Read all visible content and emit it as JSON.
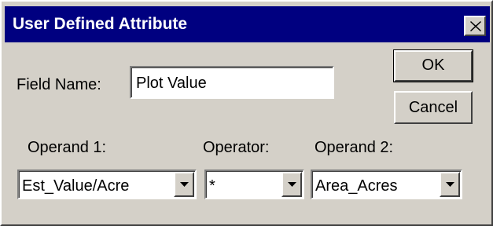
{
  "window": {
    "title": "User Defined Attribute",
    "close_icon": "close-x-icon"
  },
  "field_name": {
    "label": "Field Name:",
    "value": "Plot Value"
  },
  "buttons": {
    "ok_label": "OK",
    "cancel_label": "Cancel"
  },
  "operand1": {
    "label": "Operand 1:",
    "selected": "Est_Value/Acre"
  },
  "operator": {
    "label": "Operator:",
    "selected": "*"
  },
  "operand2": {
    "label": "Operand 2:",
    "selected": "Area_Acres"
  },
  "colors": {
    "titlebar": "#000080",
    "face": "#d4d0c8"
  }
}
